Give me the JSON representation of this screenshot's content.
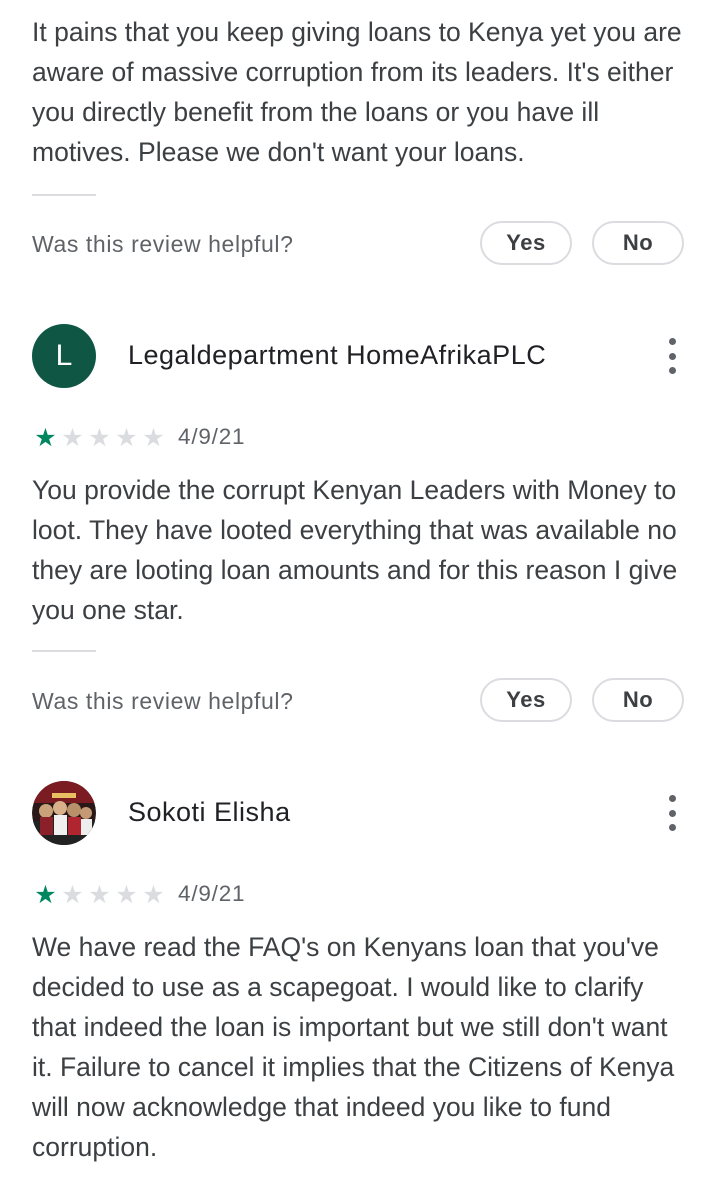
{
  "reviews": [
    {
      "text": "It pains that you keep giving loans to Kenya yet you are aware of massive corruption from its leaders. It's either you directly benefit from the loans or you have ill motives. Please we don't want your loans.",
      "helpful_prompt": "Was this review helpful?",
      "yes_label": "Yes",
      "no_label": "No"
    },
    {
      "avatar_letter": "L",
      "avatar_color": "#0f5744",
      "name": "Legaldepartment HomeAfrikaPLC",
      "rating": 1,
      "rating_max": 5,
      "date": "4/9/21",
      "text": "You provide the corrupt Kenyan Leaders with Money to loot. They have looted everything that was available no they are looting loan amounts and for this reason I give you one star.",
      "helpful_prompt": "Was this review helpful?",
      "yes_label": "Yes",
      "no_label": "No"
    },
    {
      "avatar_letter": "",
      "name": "Sokoti Elisha",
      "rating": 1,
      "rating_max": 5,
      "date": "4/9/21",
      "text": "We have read the FAQ's on Kenyans loan that you've decided to use as a scapegoat. I would like to clarify that indeed the loan is important but we still don't want it. Failure to cancel it implies that the Citizens of Kenya will now acknowledge that indeed you like to fund corruption."
    }
  ],
  "colors": {
    "star_filled": "#01875f",
    "star_empty": "#dadce0",
    "border": "#dadce0"
  },
  "icons": {
    "star": "star-icon",
    "more": "more-vert-icon"
  }
}
